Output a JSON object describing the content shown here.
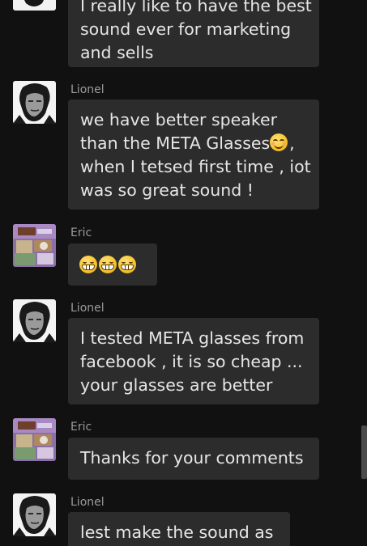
{
  "messages": [
    {
      "sender": "",
      "lines": [
        "I really like to have the best",
        "sound ever for marketing",
        "and sells"
      ]
    },
    {
      "sender": "Lionel",
      "lines": [
        "we have better speaker",
        "than the META Glasses",
        ",",
        "when I tetsed first time , iot",
        "was so great sound !"
      ],
      "emoji": "smiling-face-emoji"
    },
    {
      "sender": "Eric",
      "emojis": [
        "grinning-face-emoji",
        "grinning-face-emoji",
        "grinning-face-emoji"
      ]
    },
    {
      "sender": "Lionel",
      "lines": [
        "I tested META glasses from",
        "facebook , it is so cheap ...",
        "your glasses are better"
      ]
    },
    {
      "sender": "Eric",
      "lines": [
        "Thanks for your comments"
      ]
    },
    {
      "sender": "Lionel",
      "lines": [
        "lest make the sound as"
      ]
    }
  ],
  "colors": {
    "background": "#111111",
    "bubble": "#2c2c2c",
    "text": "#e6e6e6",
    "sender": "#9a9a9a"
  }
}
